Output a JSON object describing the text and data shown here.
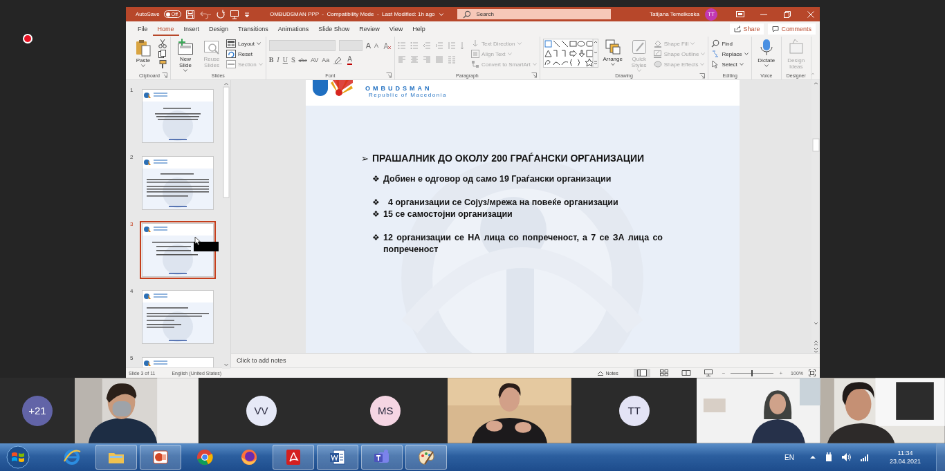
{
  "title_bar": {
    "autosave": {
      "label": "AutoSave",
      "toggle_text": "Off",
      "on": false
    },
    "document_title": "OMBUDSMAN PPP  -  Compatibility Mode  -  Last Modified: 1h ago",
    "search_placeholder": "Search",
    "user_name": "Tatijana Temelkoska",
    "user_initials": "TT"
  },
  "tabs": [
    {
      "label": "File",
      "selected": false
    },
    {
      "label": "Home",
      "selected": true
    },
    {
      "label": "Insert",
      "selected": false
    },
    {
      "label": "Design",
      "selected": false
    },
    {
      "label": "Transitions",
      "selected": false
    },
    {
      "label": "Animations",
      "selected": false
    },
    {
      "label": "Slide Show",
      "selected": false
    },
    {
      "label": "Review",
      "selected": false
    },
    {
      "label": "View",
      "selected": false
    },
    {
      "label": "Help",
      "selected": false
    }
  ],
  "share": "Share",
  "comments": "Comments",
  "ribbon": [
    {
      "label": "Clipboard",
      "launcher": true,
      "commands": [
        {
          "text": "Paste",
          "kind": "large",
          "disabled": false,
          "dropdown": true
        }
      ]
    },
    {
      "label": "Slides",
      "launcher": false,
      "commands": [
        {
          "text": "New Slide",
          "kind": "large",
          "disabled": false,
          "dropdown": true
        },
        {
          "text": "Reuse Slides",
          "kind": "large",
          "disabled": true,
          "dropdown": false
        },
        {
          "text": "Layout",
          "kind": "small",
          "disabled": false,
          "dropdown": true
        },
        {
          "text": "Reset",
          "kind": "small",
          "disabled": false,
          "dropdown": false
        },
        {
          "text": "Section",
          "kind": "small",
          "disabled": true,
          "dropdown": true
        }
      ]
    },
    {
      "label": "Font",
      "launcher": true,
      "commands": [
        {
          "text": "A",
          "kind": "glyph",
          "disabled": false
        },
        {
          "text": "A",
          "kind": "glyph",
          "disabled": false
        },
        {
          "text": "B",
          "kind": "glyph",
          "disabled": false
        },
        {
          "text": "I",
          "kind": "glyph",
          "disabled": false
        },
        {
          "text": "U",
          "kind": "glyph",
          "disabled": false
        },
        {
          "text": "S",
          "kind": "glyph",
          "disabled": false
        },
        {
          "text": "abc",
          "kind": "glyph",
          "disabled": false
        },
        {
          "text": "AV",
          "kind": "glyph",
          "disabled": false
        },
        {
          "text": "Aa",
          "kind": "glyph",
          "disabled": false
        },
        {
          "text": "A",
          "kind": "glyph",
          "disabled": false
        }
      ]
    },
    {
      "label": "Paragraph",
      "launcher": true,
      "commands": [
        {
          "text": "Text Direction",
          "kind": "small",
          "disabled": true,
          "dropdown": true
        },
        {
          "text": "Align Text",
          "kind": "small",
          "disabled": true,
          "dropdown": true
        },
        {
          "text": "Convert to SmartArt",
          "kind": "small",
          "disabled": true,
          "dropdown": true
        }
      ]
    },
    {
      "label": "Drawing",
      "launcher": true,
      "commands": [
        {
          "text": "Arrange",
          "kind": "large",
          "disabled": false,
          "dropdown": true
        },
        {
          "text": "Quick Styles",
          "kind": "large",
          "disabled": true,
          "dropdown": true
        },
        {
          "text": "Shape Fill",
          "kind": "small",
          "disabled": true,
          "dropdown": true
        },
        {
          "text": "Shape Outline",
          "kind": "small",
          "disabled": true,
          "dropdown": true
        },
        {
          "text": "Shape Effects",
          "kind": "small",
          "disabled": true,
          "dropdown": true
        }
      ]
    },
    {
      "label": "Editing",
      "launcher": false,
      "commands": [
        {
          "text": "Find",
          "kind": "small",
          "disabled": false,
          "dropdown": false
        },
        {
          "text": "Replace",
          "kind": "small",
          "disabled": false,
          "dropdown": true
        },
        {
          "text": "Select",
          "kind": "small",
          "disabled": false,
          "dropdown": true
        }
      ]
    },
    {
      "label": "Voice",
      "launcher": false,
      "commands": [
        {
          "text": "Dictate",
          "kind": "large",
          "disabled": false,
          "dropdown": true
        }
      ]
    },
    {
      "label": "Designer",
      "launcher": false,
      "commands": [
        {
          "text": "Design Ideas",
          "kind": "large",
          "disabled": true,
          "dropdown": false
        }
      ]
    }
  ],
  "thumbnails": [
    {
      "number": "1",
      "selected": false
    },
    {
      "number": "2",
      "selected": false
    },
    {
      "number": "3",
      "selected": true
    },
    {
      "number": "4",
      "selected": false
    },
    {
      "number": "5",
      "selected": false
    }
  ],
  "slide": {
    "logo_name": "OMBUDSMAN",
    "logo_subtitle": "Republic of Macedonia",
    "heading": {
      "bullet": "➢",
      "text": "ПРАШАЛНИК ДО ОКОЛУ 200 ГРАЃАНСКИ ОРГАНИЗАЦИИ"
    },
    "bullet_groups": [
      [
        {
          "bullet": "❖",
          "text": "Добиен е одговор од само 19 Граѓански организации"
        }
      ],
      [
        {
          "bullet": "❖",
          "text": "  4 организации се Сојуз/мрежа на повеќе организации"
        },
        {
          "bullet": "❖",
          "text": "15 се самостојни организации"
        }
      ],
      [
        {
          "bullet": "❖",
          "text": "12 организации се НА лица со попреченост, а 7 се ЗА лица со попреченост"
        }
      ]
    ]
  },
  "notes_placeholder": "Click to add notes",
  "status_bar": {
    "slide_position": "Slide 3 of 11",
    "language": "English (United States)",
    "notes": "Notes",
    "zoom_out": "−",
    "zoom_in": "+",
    "zoom": {
      "level": 0.5,
      "reading": "100%"
    }
  },
  "participants": [
    {
      "kind": "avatar",
      "initials": "+21",
      "color": "#6264a7"
    },
    {
      "kind": "video"
    },
    {
      "kind": "avatar",
      "initials": "VV",
      "color": "#e6e9f7"
    },
    {
      "kind": "avatar",
      "initials": "MS",
      "color": "#f5d5e3"
    },
    {
      "kind": "video"
    },
    {
      "kind": "avatar",
      "initials": "TT",
      "color": "#e3e3f5"
    },
    {
      "kind": "video"
    },
    {
      "kind": "video"
    }
  ],
  "taskbar": {
    "apps": [
      {
        "running": false
      },
      {
        "running": true
      },
      {
        "running": true
      },
      {
        "running": false
      },
      {
        "running": false
      },
      {
        "running": true
      },
      {
        "running": true
      },
      {
        "running": true
      },
      {
        "running": true
      }
    ],
    "language": "EN",
    "time": "11:34",
    "date": "23.04.2021"
  }
}
